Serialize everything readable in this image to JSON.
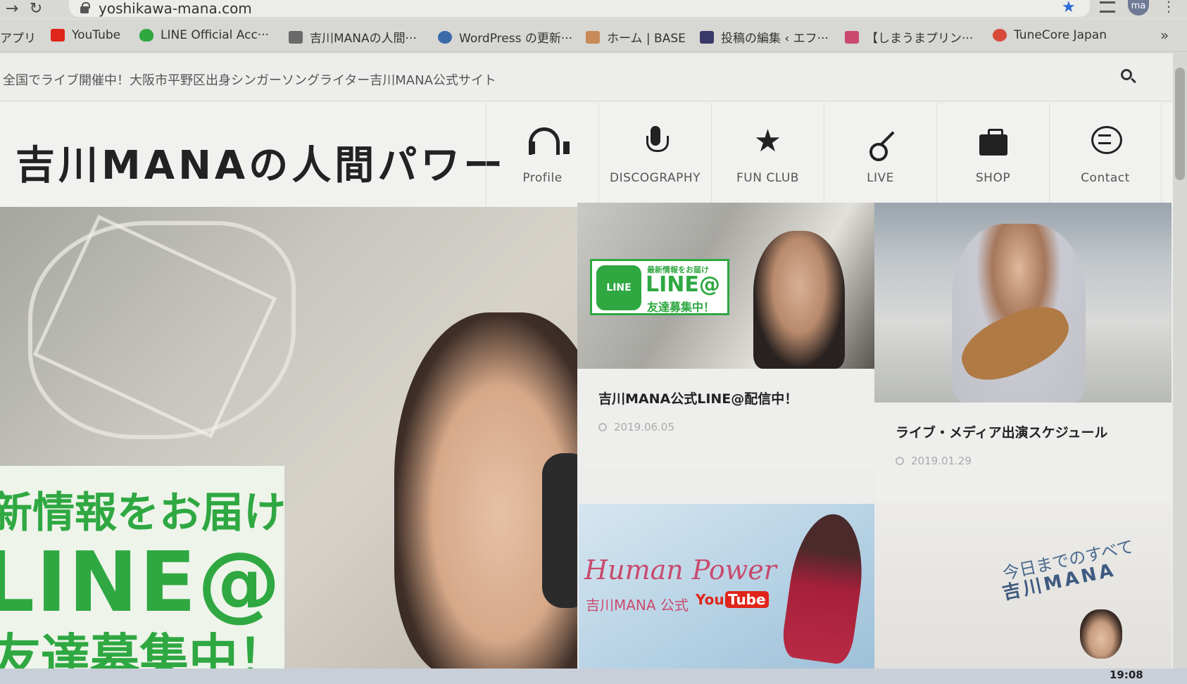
{
  "browser": {
    "url": "yoshikawa-mana.com",
    "avatar_initials": "ma",
    "bookmarks": [
      {
        "label": "アプリ",
        "icon": "apps-icon",
        "color": "#d7d7d3"
      },
      {
        "label": "YouTube",
        "icon": "youtube-icon",
        "color": "#e0251b"
      },
      {
        "label": "LINE Official Acc···",
        "icon": "line-shield-icon",
        "color": "#2fa842"
      },
      {
        "label": "吉川MANAの人間···",
        "icon": "site-favicon",
        "color": "#6a6a6a"
      },
      {
        "label": "WordPress の更新···",
        "icon": "wordpress-icon",
        "color": "#3a6aa8"
      },
      {
        "label": "ホーム | BASE",
        "icon": "base-icon",
        "color": "#c98a5a"
      },
      {
        "label": "投稿の編集 ‹ エフ···",
        "icon": "fm-icon",
        "color": "#3a3a6a"
      },
      {
        "label": "【しまうまプリン···",
        "icon": "zebra-icon",
        "color": "#c94a6e"
      },
      {
        "label": "TuneCore Japan",
        "icon": "tunecore-icon",
        "color": "#d84a3a"
      }
    ]
  },
  "page": {
    "tagline": "全国でライブ開催中！大阪市平野区出身シンガーソングライター吉川MANA公式サイト",
    "site_title": "吉川MANAの人間パワー",
    "nav": [
      {
        "label": "Profile",
        "icon": "headphones-icon"
      },
      {
        "label": "DISCOGRAPHY",
        "icon": "microphone-icon"
      },
      {
        "label": "FUN CLUB",
        "icon": "star-icon"
      },
      {
        "label": "LIVE",
        "icon": "guitar-icon"
      },
      {
        "label": "SHOP",
        "icon": "shopping-bag-icon"
      },
      {
        "label": "Contact",
        "icon": "chat-bubble-icon"
      }
    ],
    "hero": {
      "line1": "新情報をお届け",
      "line2": "LINE@",
      "line3": "友達募集中！"
    },
    "cards": [
      {
        "title": "吉川MANA公式LINE@配信中！",
        "date": "2019.06.05",
        "badge_logo": "LINE",
        "badge_small": "最新情報をお届け",
        "badge_big": "LINE@",
        "badge_sub": "友達募集中！"
      },
      {
        "title": "ライブ・メディア出演スケジュール",
        "date": "2019.01.29"
      },
      {
        "banner_title": "Human Power",
        "banner_sub": "吉川MANA 公式",
        "banner_you": "You",
        "banner_tube": "Tube"
      },
      {
        "banner_line1": "今日までのすべて",
        "banner_line2": "吉川MANA"
      }
    ]
  },
  "system": {
    "time": "19:08"
  },
  "colors": {
    "line_green": "#2fa842",
    "youtube_red": "#e0251b",
    "accent_pink": "#c94a6e",
    "star_blue": "#2a6ad8"
  }
}
